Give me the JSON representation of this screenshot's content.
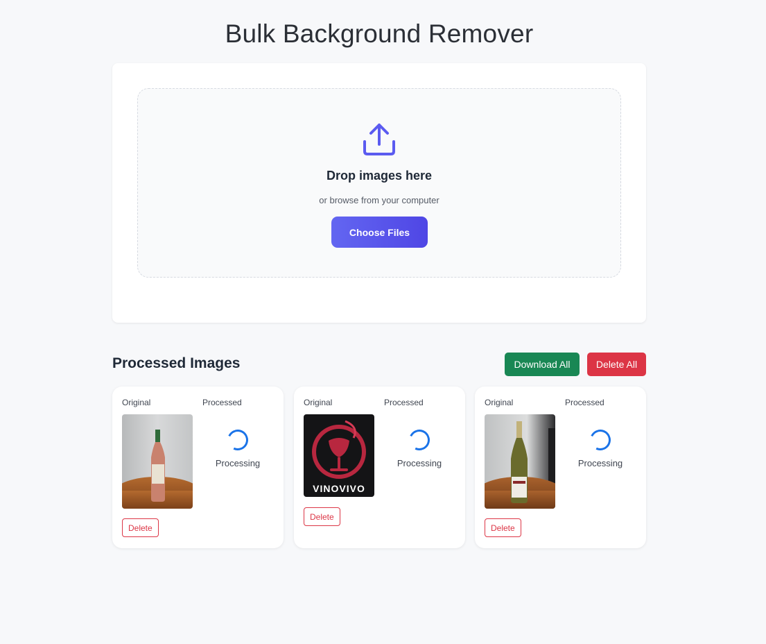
{
  "page": {
    "title": "Bulk Background Remover"
  },
  "upload": {
    "icon": "upload-icon",
    "drop_title": "Drop images here",
    "drop_subtitle": "or browse from your computer",
    "choose_button": "Choose Files",
    "accent_color": "#5b5bf0"
  },
  "processed": {
    "title": "Processed Images",
    "download_all_label": "Download All",
    "delete_all_label": "Delete All",
    "colors": {
      "download": "#198754",
      "delete": "#dc3545",
      "spinner": "#1a73e8"
    },
    "cards": [
      {
        "original_label": "Original",
        "processed_label": "Processed",
        "status": "Processing",
        "delete_label": "Delete",
        "thumbnail": "rose wine bottle on wooden table"
      },
      {
        "original_label": "Original",
        "processed_label": "Processed",
        "status": "Processing",
        "delete_label": "Delete",
        "thumbnail": "VINOVIVO logo",
        "logo_text": "VINOVIVO"
      },
      {
        "original_label": "Original",
        "processed_label": "Processed",
        "status": "Processing",
        "delete_label": "Delete",
        "thumbnail": "white wine bottle on wooden table"
      }
    ]
  }
}
